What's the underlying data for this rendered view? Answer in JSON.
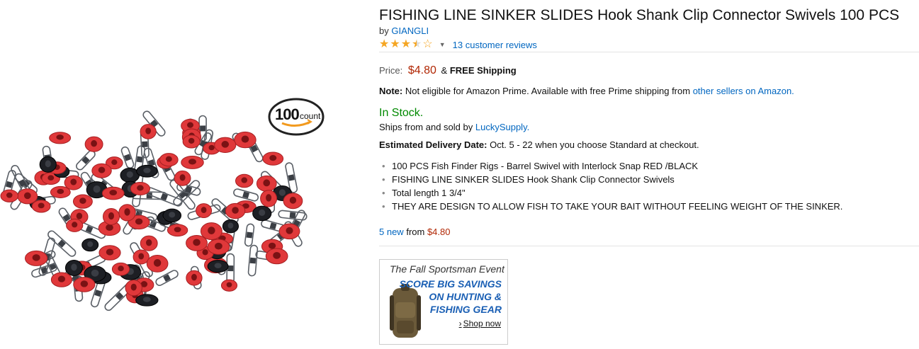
{
  "product": {
    "title": "FISHING LINE SINKER SLIDES Hook Shank Clip Connector Swivels 100 PCS",
    "by_prefix": "by",
    "brand": "GIANGLI",
    "rating_stars": 3.5,
    "reviews_link": "13 customer reviews",
    "price_label": "Price:",
    "price": "$4.80",
    "shipping_amp": "&",
    "shipping": "FREE Shipping",
    "note_label": "Note:",
    "note_text": "Not eligible for Amazon Prime. Available with free Prime shipping from",
    "note_link": "other sellers on Amazon.",
    "stock": "In Stock.",
    "ships_prefix": "Ships from and sold by",
    "seller": "LuckySupply.",
    "delivery_label": "Estimated Delivery Date:",
    "delivery_text": "Oct. 5 - 22 when you choose Standard at checkout.",
    "bullets": [
      "100 PCS Fish Finder Rigs - Barrel Swivel with Interlock Snap RED /BLACK",
      "FISHING LINE SINKER SLIDES Hook Shank Clip Connector Swivels",
      "Total length 1 3/4\"",
      "THEY ARE DESIGN TO ALLOW FISH TO TAKE YOUR BAIT WITHOUT FEELING WEIGHT OF THE SINKER."
    ],
    "offers_link": "5 new",
    "offers_from": "from",
    "offers_price": "$4.80",
    "image_badge_number": "100",
    "image_badge_word": "count"
  },
  "ad": {
    "headline": "The Fall Sportsman Event",
    "line1": "SCORE BIG SAVINGS",
    "line2": "ON HUNTING &",
    "line3": "FISHING GEAR",
    "cta": "Shop now"
  },
  "colors": {
    "link": "#0066c0",
    "price": "#b12704",
    "in_stock": "#008a00",
    "star": "#f5a623",
    "ad_blue": "#1a5fb4"
  },
  "icons": [
    "star-icon",
    "caret-down-icon",
    "chevron-right-icon"
  ]
}
